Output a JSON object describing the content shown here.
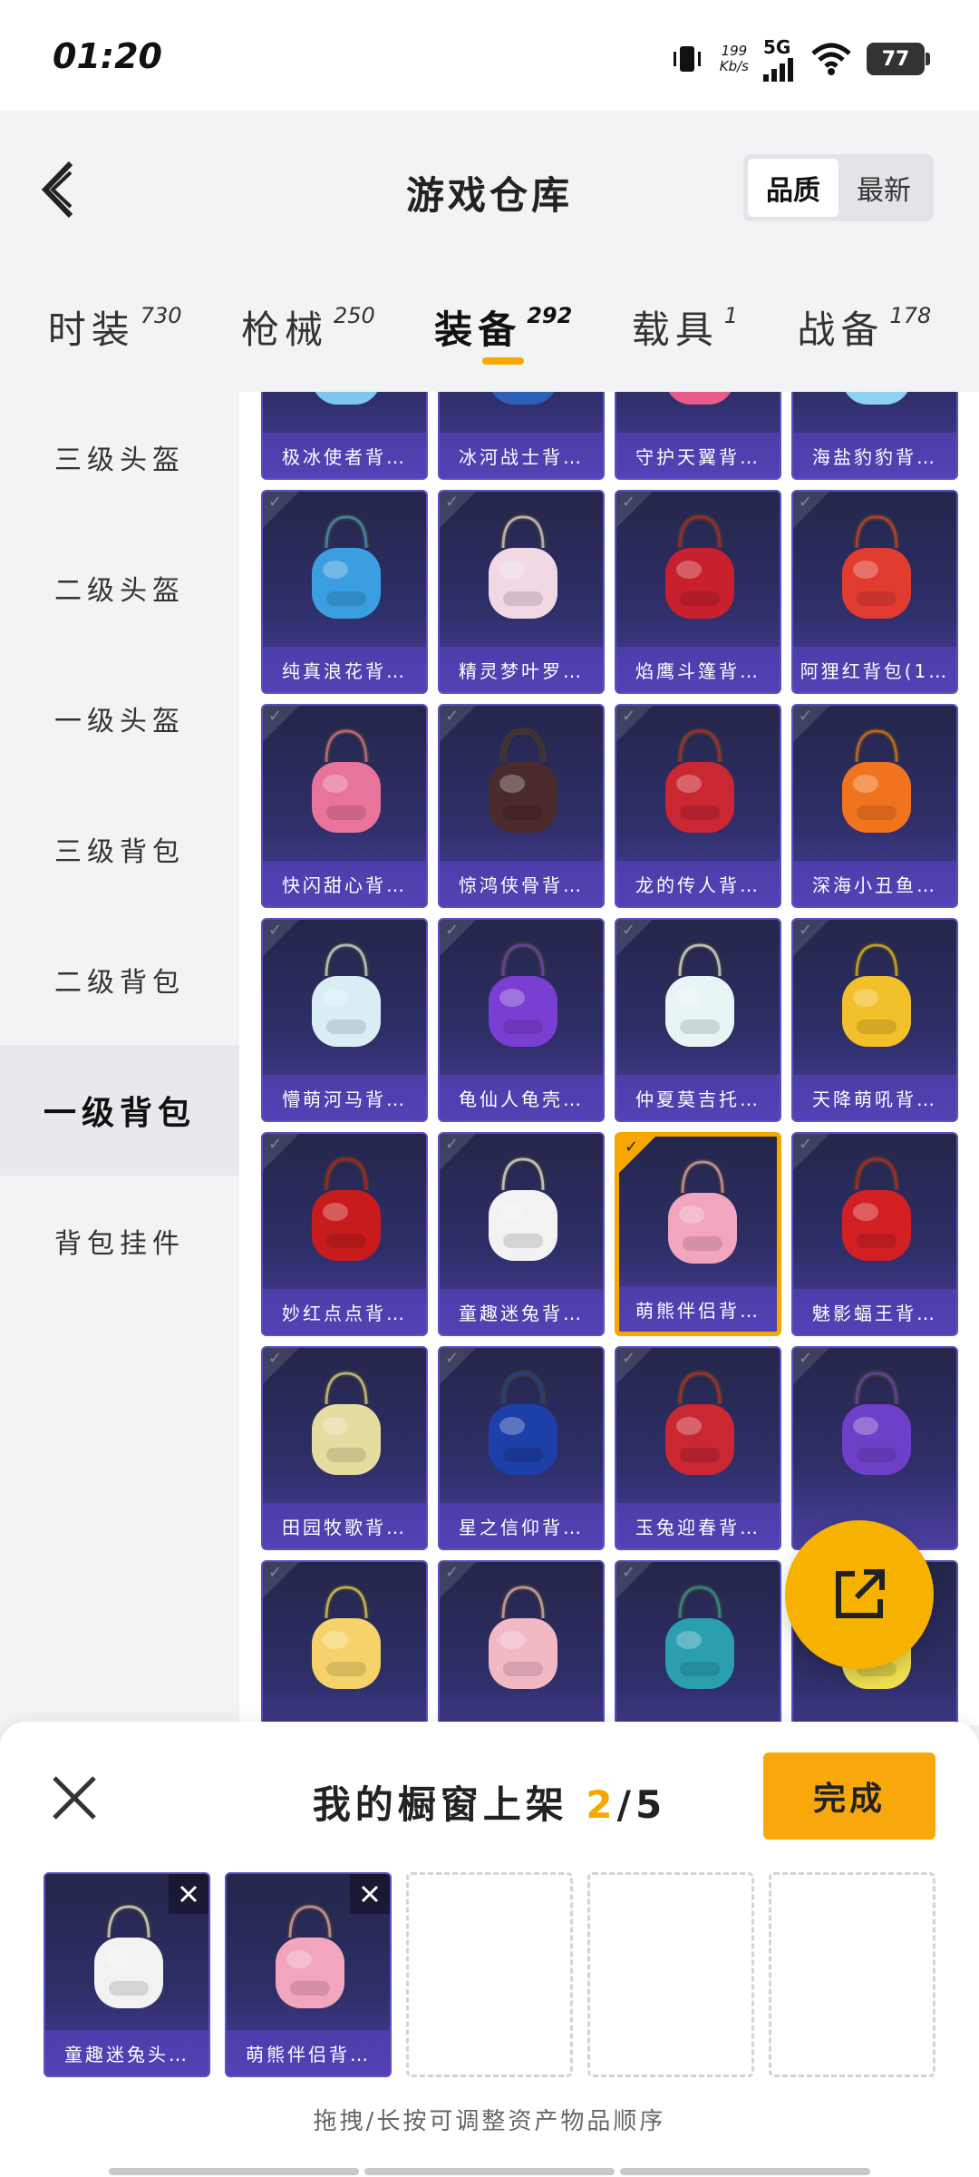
{
  "status": {
    "time": "01:20",
    "speed_value": "199",
    "speed_unit": "Kb/s",
    "network": "5G",
    "battery": "77"
  },
  "header": {
    "title": "游戏仓库",
    "sort_options": [
      "品质",
      "最新"
    ],
    "active_sort": "品质"
  },
  "categories": [
    {
      "label": "时装",
      "count": "730"
    },
    {
      "label": "枪械",
      "count": "250"
    },
    {
      "label": "装备",
      "count": "292",
      "active": true
    },
    {
      "label": "载具",
      "count": "1"
    },
    {
      "label": "战备",
      "count": "178"
    }
  ],
  "sidebar": [
    "三级头盔",
    "二级头盔",
    "一级头盔",
    "三级背包",
    "二级背包",
    "一级背包",
    "背包挂件"
  ],
  "sidebar_active": "一级背包",
  "items": [
    {
      "label": "极冰使者背…",
      "color": "#7ec8f0"
    },
    {
      "label": "冰河战士背…",
      "color": "#2b5fb8"
    },
    {
      "label": "守护天翼背…",
      "color": "#e85b8b"
    },
    {
      "label": "海盐豹豹背…",
      "color": "#8fd1f2"
    },
    {
      "label": "纯真浪花背…",
      "color": "#3a9ee0"
    },
    {
      "label": "精灵梦叶罗…",
      "color": "#f2d8e4"
    },
    {
      "label": "焰鹰斗篷背…",
      "color": "#c8202c"
    },
    {
      "label": "阿狸红背包(1…",
      "color": "#e23b30"
    },
    {
      "label": "快闪甜心背…",
      "color": "#e8739b"
    },
    {
      "label": "惊鸿侠骨背…",
      "color": "#4a2a2a"
    },
    {
      "label": "龙的传人背…",
      "color": "#c92732"
    },
    {
      "label": "深海小丑鱼…",
      "color": "#f0741e"
    },
    {
      "label": "懵萌河马背…",
      "color": "#d9eef4"
    },
    {
      "label": "龟仙人龟壳…",
      "color": "#7a3ed2"
    },
    {
      "label": "仲夏莫吉托…",
      "color": "#e8f4f6"
    },
    {
      "label": "天降萌吼背…",
      "color": "#f2c02a"
    },
    {
      "label": "妙红点点背…",
      "color": "#c81c1c"
    },
    {
      "label": "童趣迷兔背…",
      "color": "#f2f2f2"
    },
    {
      "label": "萌熊伴侣背…",
      "color": "#f2a6be",
      "selected": true
    },
    {
      "label": "魅影蝠王背…",
      "color": "#d21f22"
    },
    {
      "label": "田园牧歌背…",
      "color": "#e6dca0"
    },
    {
      "label": "星之信仰背…",
      "color": "#1c3fa8"
    },
    {
      "label": "玉兔迎春背…",
      "color": "#c92732"
    },
    {
      "label": "",
      "color": "#6e40c8"
    },
    {
      "label": "",
      "color": "#f5d36a"
    },
    {
      "label": "",
      "color": "#f2b8c4"
    },
    {
      "label": "",
      "color": "#2b9fb0"
    },
    {
      "label": "",
      "color": "#f0e050"
    }
  ],
  "panel": {
    "title_prefix": "我的橱窗上架",
    "count": "2",
    "total": "/5",
    "done_label": "完成",
    "hint": "拖拽/长按可调整资产物品顺序",
    "slots": [
      {
        "label": "童趣迷兔头…",
        "color": "#f2f2f2"
      },
      {
        "label": "萌熊伴侣背…",
        "color": "#f2a6be"
      }
    ]
  },
  "colors": {
    "accent": "#f6a800",
    "card_bg": "#2f2f6a",
    "card_border": "#5b4fc4"
  }
}
